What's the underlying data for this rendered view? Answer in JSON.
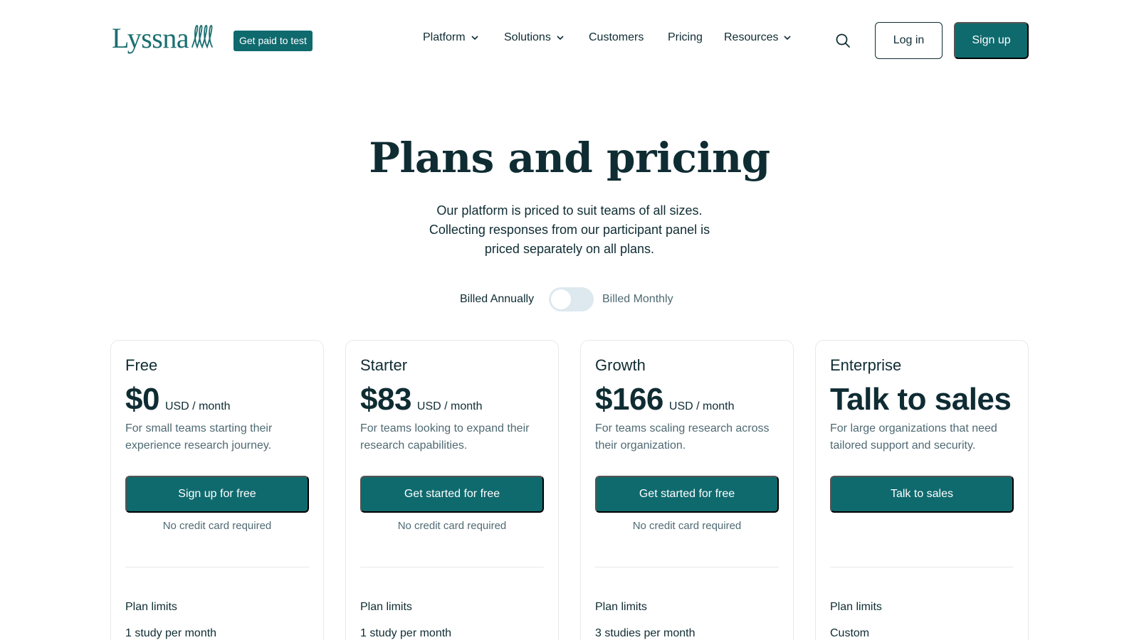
{
  "header": {
    "logo_text": "Lyssna",
    "paid_badge": "Get paid to test",
    "nav": [
      {
        "label": "Platform",
        "has_dropdown": true
      },
      {
        "label": "Solutions",
        "has_dropdown": true
      },
      {
        "label": "Customers",
        "has_dropdown": false
      },
      {
        "label": "Pricing",
        "has_dropdown": false
      },
      {
        "label": "Resources",
        "has_dropdown": true
      }
    ],
    "login_label": "Log in",
    "signup_label": "Sign up"
  },
  "hero": {
    "title": "Plans and pricing",
    "subtitle": "Our platform is priced to suit teams of all sizes. Collecting responses from our participant panel is priced separately on all plans."
  },
  "billing": {
    "annual_label": "Billed Annually",
    "monthly_label": "Billed Monthly",
    "selected": "Billed Annually"
  },
  "plans": [
    {
      "name": "Free",
      "price": "$0",
      "unit": "USD / month",
      "description": "For small teams starting their experience research journey.",
      "cta": "Sign up for free",
      "note": "No credit card required",
      "limits_heading": "Plan limits",
      "limit_first": "1 study per month"
    },
    {
      "name": "Starter",
      "price": "$83",
      "unit": "USD / month",
      "description": "For teams looking to expand their research capabilities.",
      "cta": "Get started for free",
      "note": "No credit card required",
      "limits_heading": "Plan limits",
      "limit_first": "1 study per month"
    },
    {
      "name": "Growth",
      "price": "$166",
      "unit": "USD / month",
      "description": "For teams scaling research across their organization.",
      "cta": "Get started for free",
      "note": "No credit card required",
      "limits_heading": "Plan limits",
      "limit_first": "3 studies per month"
    },
    {
      "name": "Enterprise",
      "price": "Talk to sales",
      "unit": "",
      "description": "For large organizations that need tailored support and security.",
      "cta": "Talk to sales",
      "note": "",
      "limits_heading": "Plan limits",
      "limit_first": "Custom"
    }
  ],
  "colors": {
    "brand": "#0f6a6e",
    "text": "#0f2c33",
    "muted": "#4f6a73",
    "toggle_track": "#dde9ef"
  },
  "icons": {
    "search": "search-icon",
    "chevron": "chevron-down-icon",
    "logo_mark": "wave-loops-icon"
  }
}
